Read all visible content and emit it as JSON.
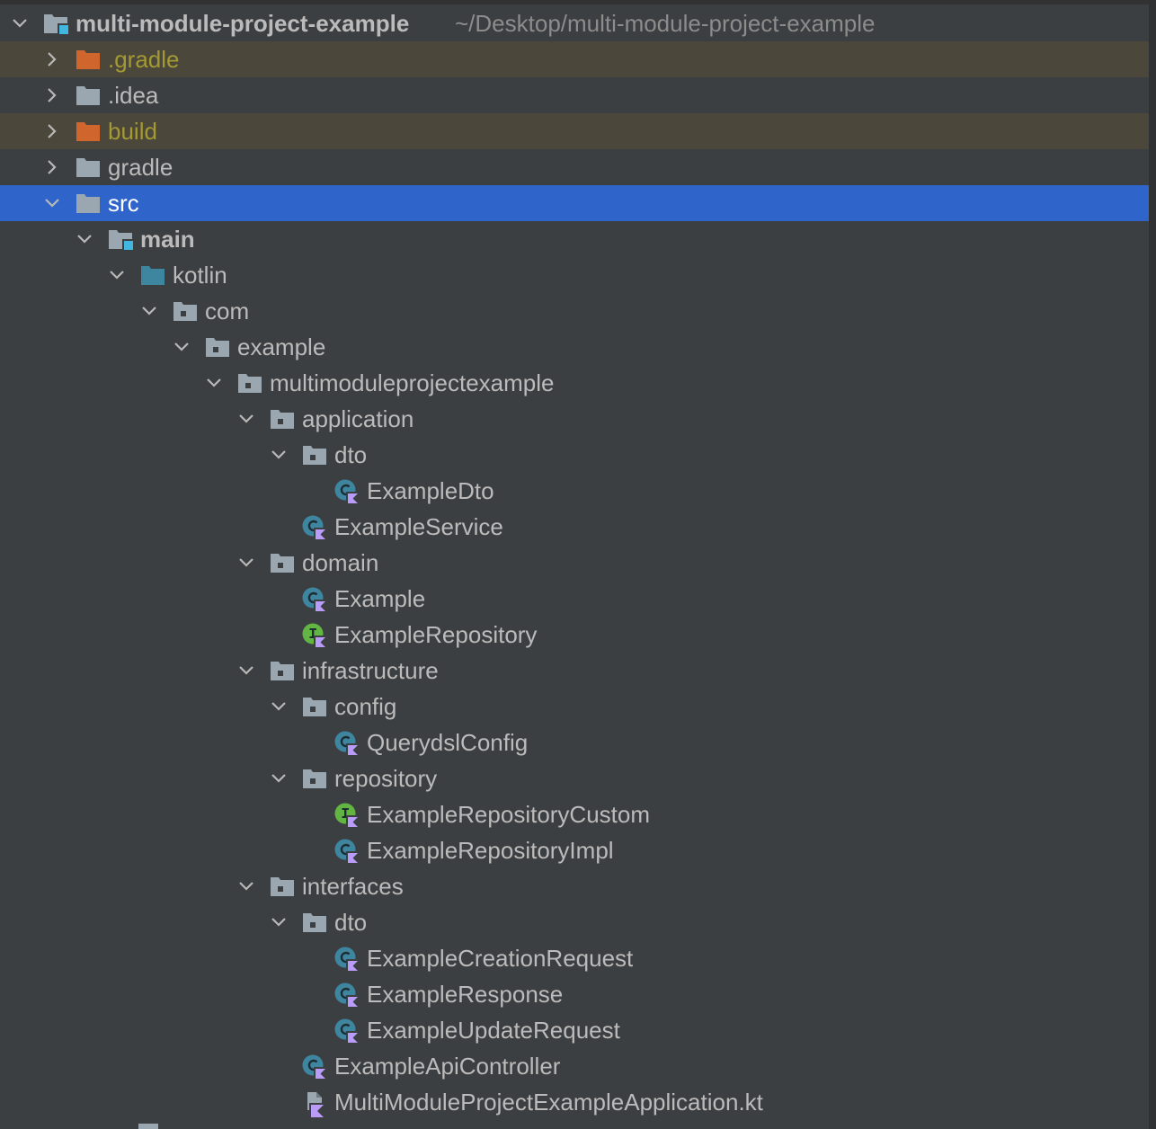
{
  "tree": [
    {
      "label": "multi-module-project-example",
      "path": "~/Desktop/multi-module-project-example",
      "level": 0,
      "expanded": true,
      "icon": "module-folder-icon",
      "bold": true
    },
    {
      "label": ".gradle",
      "level": 1,
      "expanded": false,
      "icon": "excluded-folder-icon",
      "excluded": true
    },
    {
      "label": ".idea",
      "level": 1,
      "expanded": false,
      "icon": "folder-icon"
    },
    {
      "label": "build",
      "level": 1,
      "expanded": false,
      "icon": "excluded-folder-icon",
      "excluded": true
    },
    {
      "label": "gradle",
      "level": 1,
      "expanded": false,
      "icon": "folder-icon"
    },
    {
      "label": "src",
      "level": 1,
      "expanded": true,
      "icon": "folder-icon",
      "selected": true
    },
    {
      "label": "main",
      "level": 2,
      "expanded": true,
      "icon": "module-folder-icon",
      "bold": true
    },
    {
      "label": "kotlin",
      "level": 3,
      "expanded": true,
      "icon": "source-root-folder-icon"
    },
    {
      "label": "com",
      "level": 4,
      "expanded": true,
      "icon": "package-icon"
    },
    {
      "label": "example",
      "level": 5,
      "expanded": true,
      "icon": "package-icon"
    },
    {
      "label": "multimoduleprojectexample",
      "level": 6,
      "expanded": true,
      "icon": "package-icon"
    },
    {
      "label": "application",
      "level": 7,
      "expanded": true,
      "icon": "package-icon"
    },
    {
      "label": "dto",
      "level": 8,
      "expanded": true,
      "icon": "package-icon"
    },
    {
      "label": "ExampleDto",
      "level": 9,
      "icon": "kotlin-class-icon"
    },
    {
      "label": "ExampleService",
      "level": 8,
      "icon": "kotlin-class-icon"
    },
    {
      "label": "domain",
      "level": 7,
      "expanded": true,
      "icon": "package-icon"
    },
    {
      "label": "Example",
      "level": 8,
      "icon": "kotlin-class-icon"
    },
    {
      "label": "ExampleRepository",
      "level": 8,
      "icon": "kotlin-interface-icon"
    },
    {
      "label": "infrastructure",
      "level": 7,
      "expanded": true,
      "icon": "package-icon"
    },
    {
      "label": "config",
      "level": 8,
      "expanded": true,
      "icon": "package-icon"
    },
    {
      "label": "QuerydslConfig",
      "level": 9,
      "icon": "kotlin-class-icon"
    },
    {
      "label": "repository",
      "level": 8,
      "expanded": true,
      "icon": "package-icon"
    },
    {
      "label": "ExampleRepositoryCustom",
      "level": 9,
      "icon": "kotlin-interface-icon"
    },
    {
      "label": "ExampleRepositoryImpl",
      "level": 9,
      "icon": "kotlin-class-icon"
    },
    {
      "label": "interfaces",
      "level": 7,
      "expanded": true,
      "icon": "package-icon"
    },
    {
      "label": "dto",
      "level": 8,
      "expanded": true,
      "icon": "package-icon"
    },
    {
      "label": "ExampleCreationRequest",
      "level": 9,
      "icon": "kotlin-class-icon"
    },
    {
      "label": "ExampleResponse",
      "level": 9,
      "icon": "kotlin-class-icon"
    },
    {
      "label": "ExampleUpdateRequest",
      "level": 9,
      "icon": "kotlin-class-icon"
    },
    {
      "label": "ExampleApiController",
      "level": 8,
      "icon": "kotlin-class-icon"
    },
    {
      "label": "MultiModuleProjectExampleApplication.kt",
      "level": 8,
      "icon": "kotlin-file-icon"
    }
  ],
  "colors": {
    "background": "#3c3f41",
    "selected_row": "#2f65ca",
    "excluded_row": "#4c473b",
    "excluded_text": "#a39a33",
    "folder": "#9aa7b0",
    "excluded_folder": "#d0652d",
    "source_root_folder": "#3e86a0",
    "class_circle": "#3e86a0",
    "interface_circle": "#62b543",
    "kotlin_badge": "#b99bf8"
  }
}
